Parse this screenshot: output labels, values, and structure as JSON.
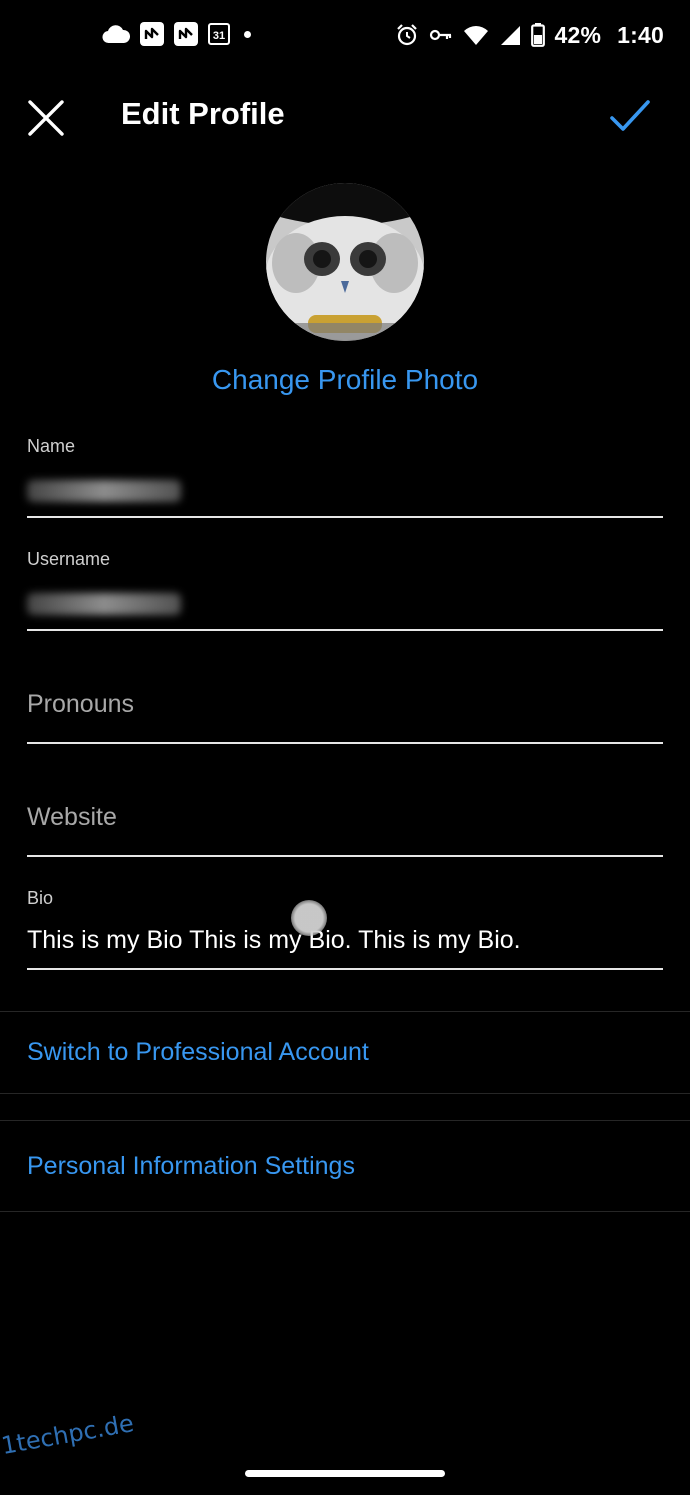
{
  "status_bar": {
    "battery": "42%",
    "time": "1:40",
    "calendar_day": "31"
  },
  "header": {
    "title": "Edit Profile"
  },
  "profile": {
    "change_photo_label": "Change Profile Photo"
  },
  "fields": {
    "name": {
      "label": "Name",
      "value_blurred": true
    },
    "username": {
      "label": "Username",
      "value_blurred": true
    },
    "pronouns": {
      "placeholder": "Pronouns"
    },
    "website": {
      "placeholder": "Website"
    },
    "bio": {
      "label": "Bio",
      "value": "This is my Bio This is my Bio. This is my Bio."
    }
  },
  "links": {
    "professional": "Switch to Professional Account",
    "personal_info": "Personal Information Settings"
  },
  "watermark": "1techpc.de",
  "colors": {
    "background": "#000000",
    "accent": "#3897f0",
    "text": "#ffffff",
    "placeholder": "#a8a8a8",
    "underline": "#e6e6e6"
  },
  "icons": [
    "cloud-icon",
    "app-icon",
    "calendar-icon",
    "alarm-icon",
    "vpn-key-icon",
    "wifi-icon",
    "signal-icon",
    "battery-icon",
    "close-icon",
    "checkmark-icon"
  ]
}
